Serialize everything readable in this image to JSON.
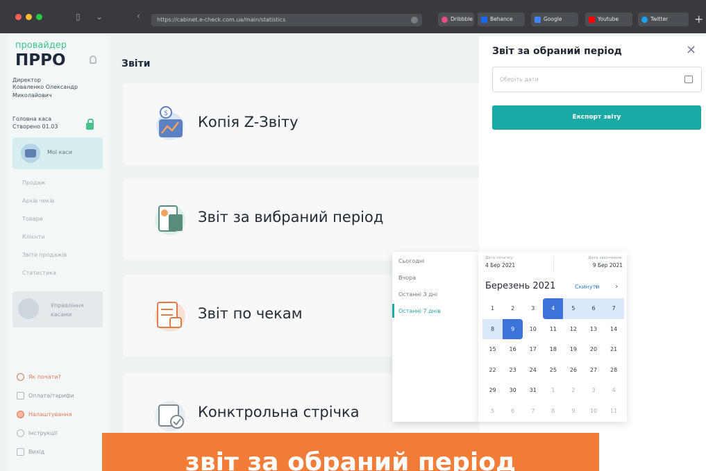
{
  "browser": {
    "url": "https://cabinet.e-check.com.ua/main/statistics",
    "bookmarks": [
      "Dribbble",
      "Behance",
      "Google",
      "Youtube",
      "Twitter"
    ]
  },
  "sidebar": {
    "logo_top": "провайдер",
    "logo_main": "ПРРО",
    "director_label": "Директор",
    "director_name": "Коваленко Олександр Миколайович",
    "cashbox_label": "Головна каса",
    "cashbox_sub": "Створено 01.03",
    "my_cash_label": "Мої каси",
    "menu": [
      "Продаж",
      "Архів чеків",
      "Товари",
      "Клієнти",
      "Звіти продажів",
      "Статистика"
    ],
    "management_label": "Управління касами",
    "bottom": [
      "Як почати?",
      "Оплата/тарифи",
      "Налаштування",
      "Інструкції",
      "Вихід"
    ]
  },
  "main": {
    "title": "Звіти",
    "cards": [
      "Копія Z-Звіту",
      "Звіт за вибраний період",
      "Звіт по чекам",
      "Конктрольна стрічка"
    ]
  },
  "panel": {
    "title": "Звіт за обраний період",
    "date_placeholder": "Оберіть дати",
    "export_label": "Експорт звіту"
  },
  "datepicker": {
    "quick_options": [
      "Сьогодні",
      "Вчора",
      "Останні 3 дні",
      "Останні 7 днів"
    ],
    "active_option": "Останні 7 днів",
    "start_label": "Дата початку:",
    "start_value": "4 Бер 2021",
    "end_label": "Дата закінчення:",
    "end_value": "9 Бер 2021",
    "month": "Березень 2021",
    "reset_label": "Скинути",
    "prev": "‹",
    "next": "›",
    "weeks": [
      [
        "1",
        "2",
        "3",
        "4",
        "5",
        "6",
        "7"
      ],
      [
        "8",
        "9",
        "10",
        "11",
        "12",
        "13",
        "14"
      ],
      [
        "15",
        "16",
        "17",
        "18",
        "19",
        "20",
        "21"
      ],
      [
        "22",
        "23",
        "24",
        "25",
        "26",
        "27",
        "28"
      ],
      [
        "29",
        "30",
        "31",
        "1",
        "2",
        "3",
        "4"
      ],
      [
        "5",
        "6",
        "7",
        "8",
        "9",
        "10",
        "11"
      ]
    ]
  },
  "banner": {
    "text": "звіт за обраний період"
  },
  "colors": {
    "accent": "#1aa9a5",
    "selection": "#3c73d8",
    "banner": "#f07c38",
    "brand_green": "#3ec28f"
  }
}
